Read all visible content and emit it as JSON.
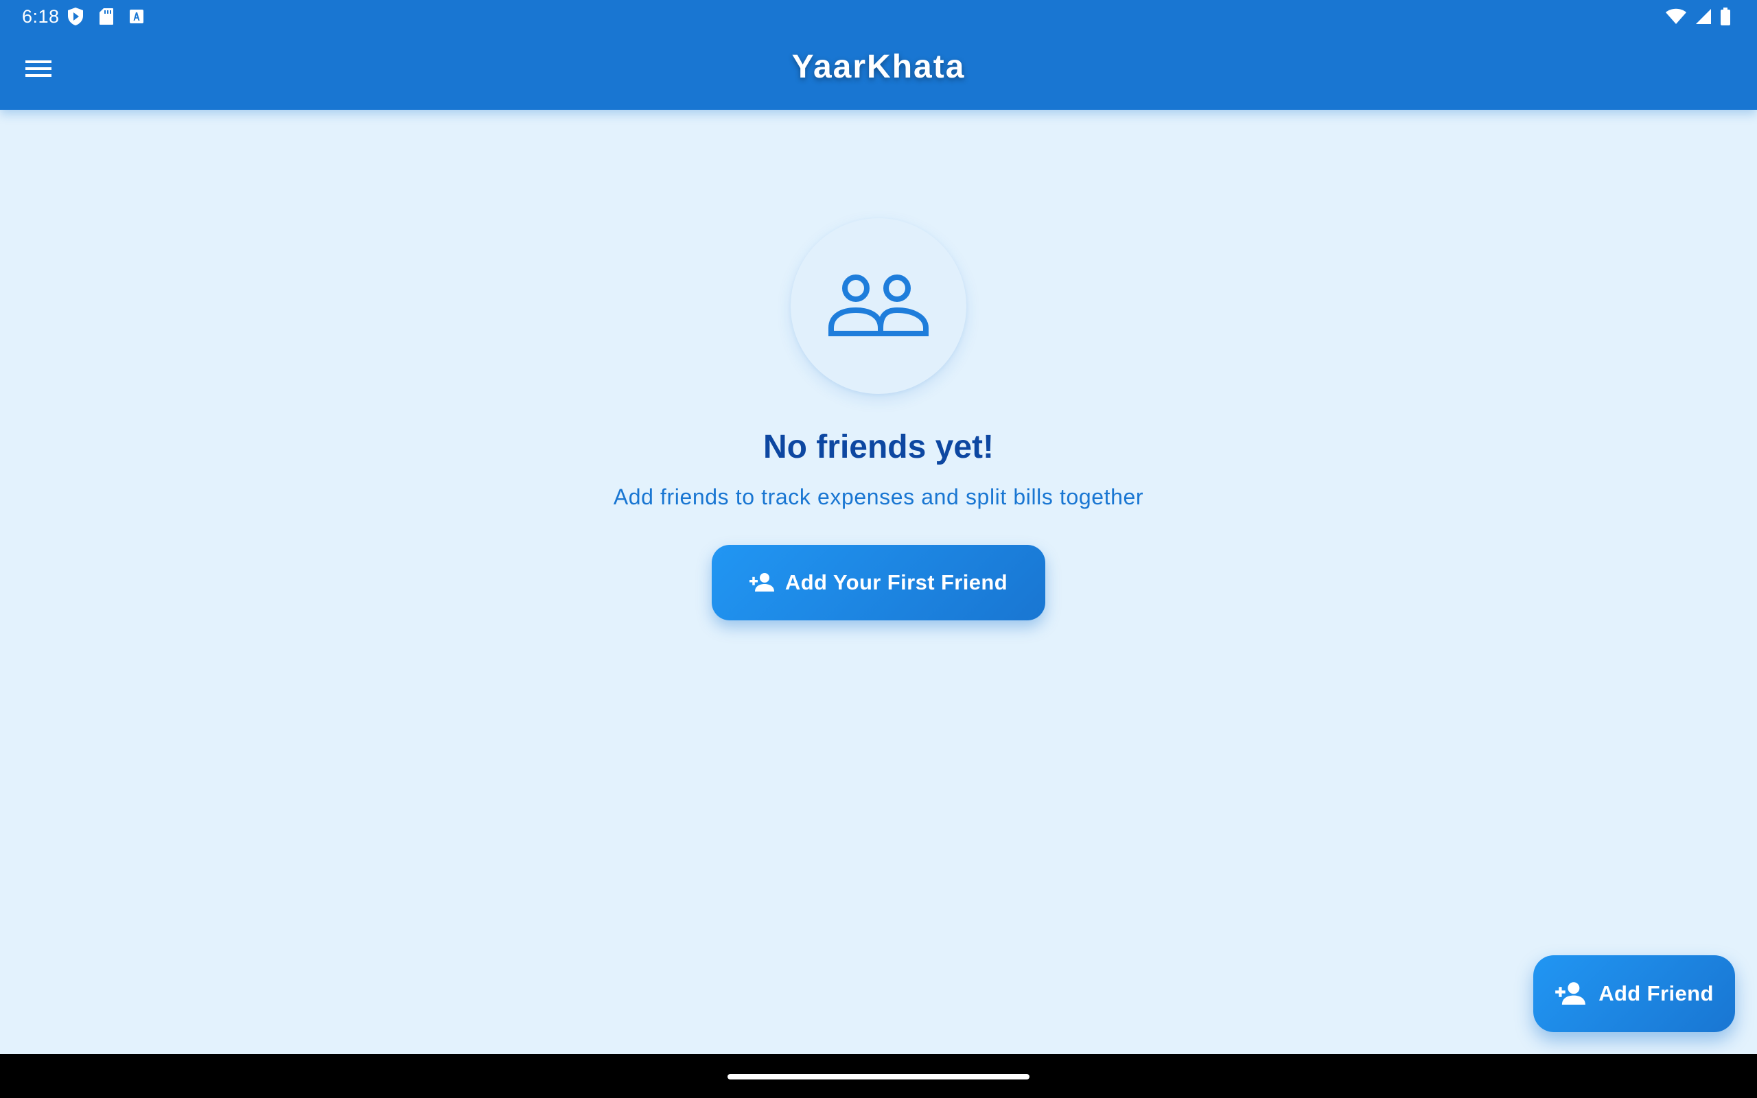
{
  "status_bar": {
    "time": "6:18",
    "left_icons": [
      "shield-play-icon",
      "sd-card-icon",
      "keyboard-a-icon"
    ],
    "right_icons": [
      "wifi-icon",
      "cellular-signal-icon",
      "battery-icon"
    ]
  },
  "app_bar": {
    "menu_icon": "hamburger-menu-icon",
    "title": "YaarKhata"
  },
  "empty_state": {
    "icon": "people-outline-icon",
    "title": "No friends yet!",
    "subtitle": "Add friends to track expenses and split bills together",
    "button_label": "Add Your First Friend",
    "button_icon": "person-add-icon"
  },
  "fab": {
    "label": "Add Friend",
    "icon": "person-add-icon"
  },
  "colors": {
    "app_bar": "#1976D2",
    "background": "#E3F2FD",
    "title_text": "#0D47A1",
    "subtitle_text": "#1976D2",
    "button_gradient_start": "#2196F3",
    "button_gradient_end": "#1976D2",
    "nav_bar": "#000000"
  }
}
